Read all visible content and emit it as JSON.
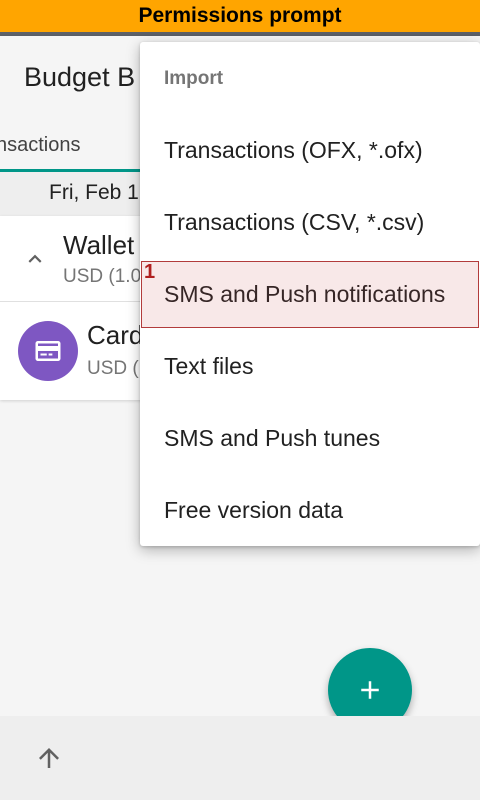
{
  "banner": {
    "text": "Permissions prompt"
  },
  "appbar": {
    "title": "Budget B"
  },
  "tabs": {
    "current": "nsactions"
  },
  "date_header": {
    "text": "Fri, Feb 1"
  },
  "accounts": [
    {
      "name": "Wallet",
      "currency": "USD (1.0",
      "expanded": true
    },
    {
      "name": "Card",
      "currency": "USD (",
      "icon": "credit-card-icon"
    }
  ],
  "colors": {
    "accent": "#009688",
    "banner": "#ffa500",
    "avatar": "#7e57c2",
    "highlight_border": "#b23b3b"
  },
  "menu": {
    "header": "Import",
    "items": [
      {
        "label": "Transactions (OFX, *.ofx)"
      },
      {
        "label": "Transactions (CSV, *.csv)"
      },
      {
        "label": "SMS and Push notifications"
      },
      {
        "label": "Text files"
      },
      {
        "label": "SMS and Push tunes"
      },
      {
        "label": "Free version data"
      }
    ]
  },
  "annotation": {
    "label": "1"
  }
}
